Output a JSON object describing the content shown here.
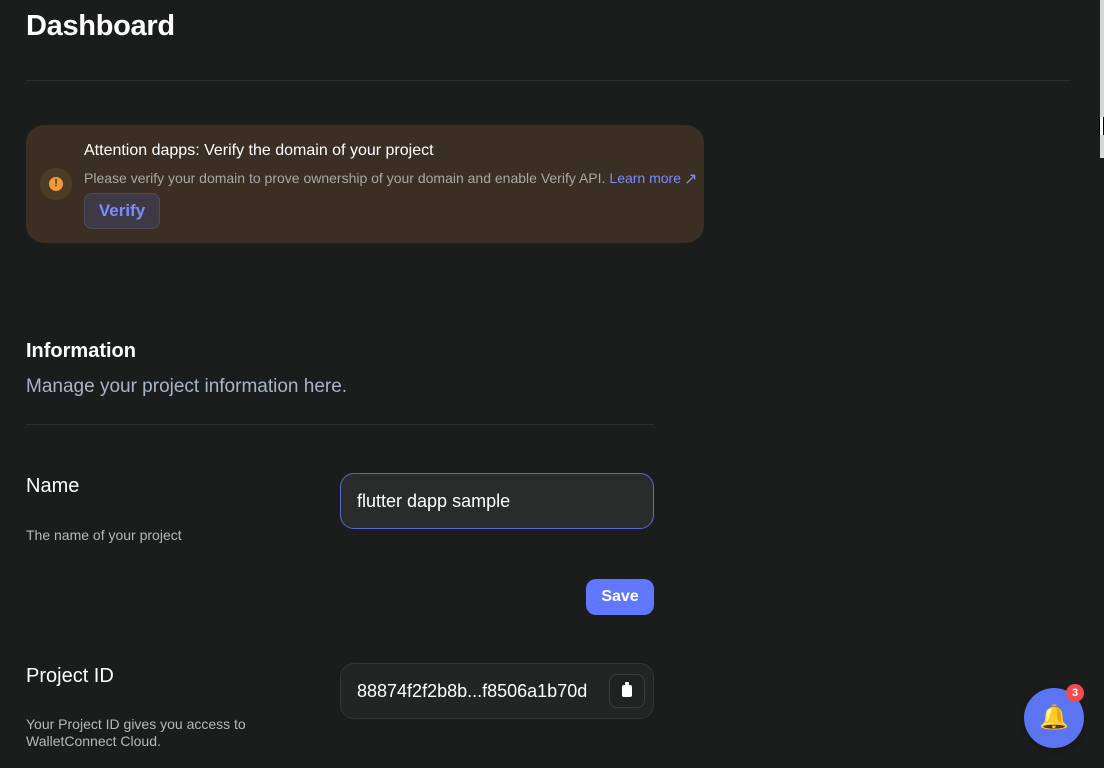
{
  "page": {
    "title": "Dashboard"
  },
  "alert": {
    "title": "Attention dapps: Verify the domain of your project",
    "text": "Please verify your domain to prove ownership of your domain and enable Verify API.",
    "learn_more": "Learn more",
    "learn_more_icon": "arrow-up-right-icon",
    "verify_label": "Verify",
    "icon": "warning-icon",
    "icon_glyph": "!",
    "colors": {
      "background": "#3a2f22",
      "warning": "#f09a39",
      "link": "#7b8cff"
    }
  },
  "information": {
    "title": "Information",
    "subtitle": "Manage your project information here."
  },
  "name_field": {
    "label": "Name",
    "help": "The name of your project",
    "value": "flutter dapp sample",
    "save_label": "Save"
  },
  "project_id": {
    "label": "Project ID",
    "help_line1": "Your Project ID gives you access to",
    "help_line2": "WalletConnect Cloud.",
    "value": "88874f2f2b8b...f8506a1b70d",
    "copy_icon": "clipboard-icon"
  },
  "notifications": {
    "icon": "bell-icon",
    "glyph": "🔔",
    "count": "3"
  }
}
